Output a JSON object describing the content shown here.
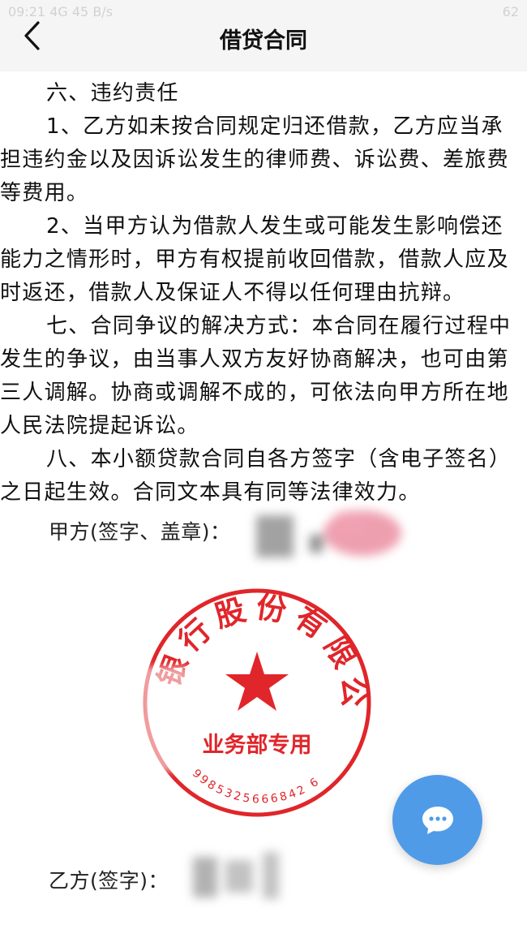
{
  "status": {
    "time": "09:21",
    "signal": "4G",
    "speed": "45 B/s",
    "battery": "62"
  },
  "nav": {
    "title": "借贷合同",
    "back_icon": "chevron-left-icon"
  },
  "contract": {
    "cut_line": "· · · · · · · ·",
    "s6_heading": "六、违约责任",
    "s6_1": "1、乙方如未按合同规定归还借款，乙方应当承担违约金以及因诉讼发生的律师费、诉讼费、差旅费等费用。",
    "s6_2": "2、当甲方认为借款人发生或可能发生影响偿还能力之情形时，甲方有权提前收回借款，借款人应及时返还，借款人及保证人不得以任何理由抗辩。",
    "s7": "七、合同争议的解决方式：本合同在履行过程中发生的争议，由当事人双方友好协商解决，也可由第三人调解。协商或调解不成的，可依法向甲方所在地人民法院提起诉讼。",
    "s8": "八、本小额贷款合同自各方签字（含电子签名）之日起生效。合同文本具有同等法律效力。"
  },
  "signatures": {
    "party_a_label": "甲方(签字、盖章)：",
    "party_b_label": "乙方(签字)："
  },
  "seal": {
    "arc_text": "银行股份有限公司",
    "dept_text": "业务部专用",
    "serial": "9985325666842 6",
    "color": "#e0262b"
  },
  "fab": {
    "icon": "chat-bubble-icon"
  },
  "colors": {
    "nav_bg": "#f5f5f5",
    "fab_bg": "#4f9be8",
    "seal_red": "#e0262b"
  }
}
